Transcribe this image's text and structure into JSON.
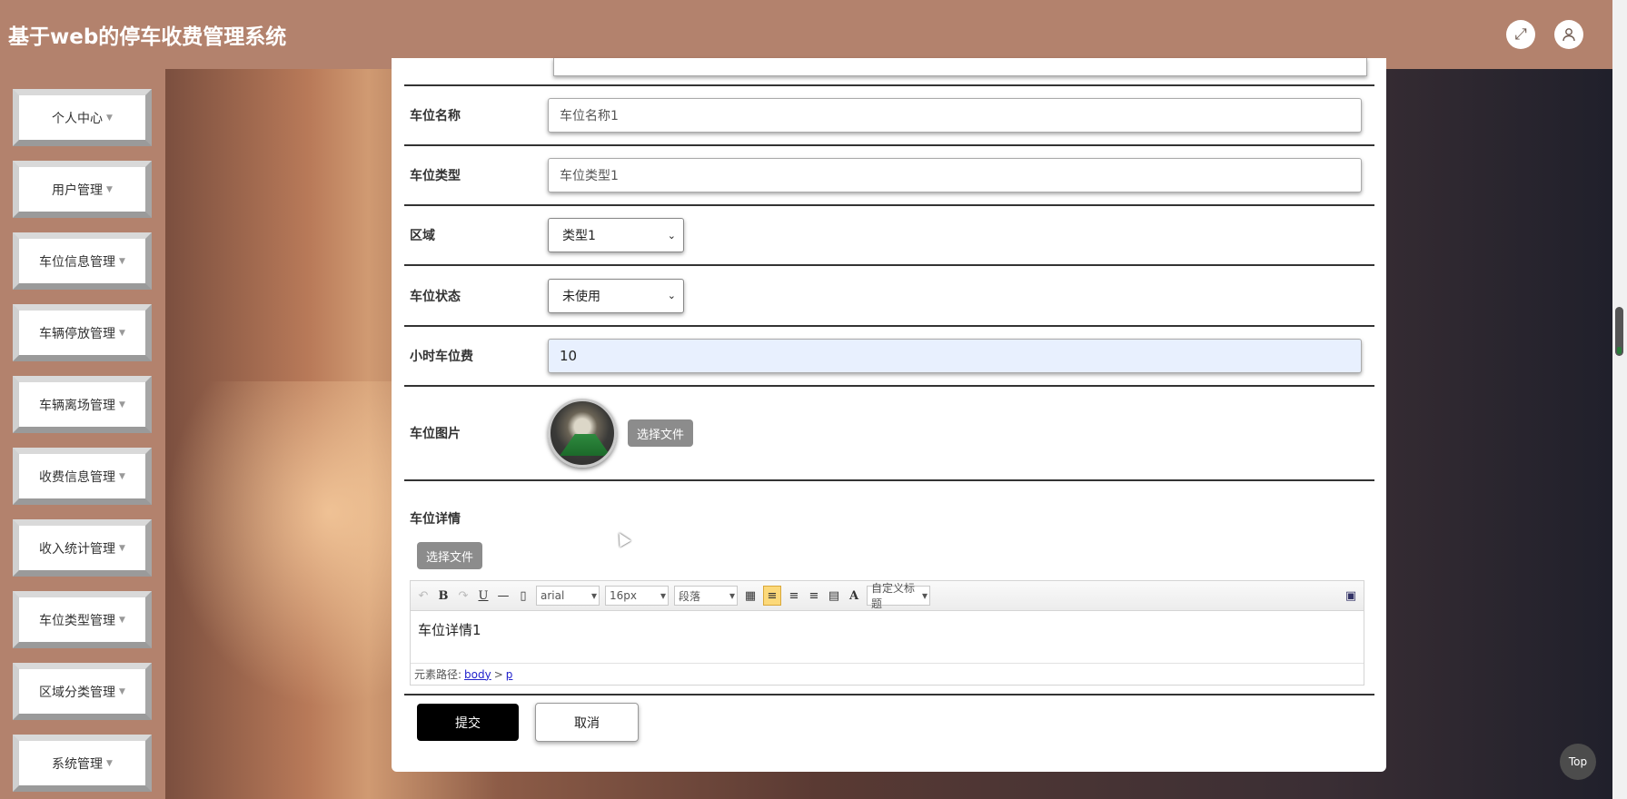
{
  "header": {
    "title": "基于web的停车收费管理系统",
    "fullscreen_icon": "expand-arrows-icon",
    "user_icon": "user-icon"
  },
  "sidebar": {
    "items": [
      {
        "label": "个人中心"
      },
      {
        "label": "用户管理"
      },
      {
        "label": "车位信息管理"
      },
      {
        "label": "车辆停放管理"
      },
      {
        "label": "车辆离场管理"
      },
      {
        "label": "收费信息管理"
      },
      {
        "label": "收入统计管理"
      },
      {
        "label": "车位类型管理"
      },
      {
        "label": "区域分类管理"
      },
      {
        "label": "系统管理"
      }
    ]
  },
  "form": {
    "space_name": {
      "label": "车位名称",
      "value": "车位名称1"
    },
    "space_type": {
      "label": "车位类型",
      "value": "车位类型1"
    },
    "area": {
      "label": "区域",
      "selected": "类型1"
    },
    "status": {
      "label": "车位状态",
      "selected": "未使用"
    },
    "hourly_fee": {
      "label": "小时车位费",
      "value": "10"
    },
    "image": {
      "label": "车位图片",
      "file_button": "选择文件"
    },
    "details": {
      "label": "车位详情",
      "file_button": "选择文件",
      "toolbar": {
        "font_family": "arial",
        "font_size": "16px",
        "paragraph": "段落",
        "custom_title": "自定义标题"
      },
      "content": "车位详情1",
      "status_prefix": "元素路径:",
      "path_body": "body",
      "path_sep": ">",
      "path_p": "p"
    },
    "submit_label": "提交",
    "cancel_label": "取消"
  },
  "top_button": "Top",
  "colors": {
    "header_bg": "#b3826d",
    "submit_bg": "#000000",
    "focused_input_bg": "#e8f0fe"
  }
}
